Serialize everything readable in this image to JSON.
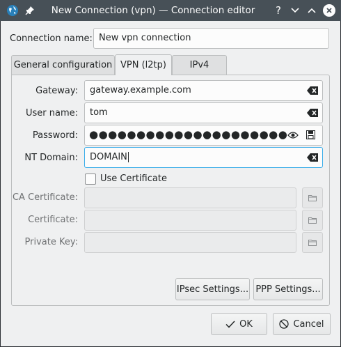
{
  "window": {
    "title": "New Connection (vpn) — Connection editor"
  },
  "titlebar": {
    "app_icon": "network-globe-icon",
    "pin_icon": "pin-icon",
    "help_label": "?",
    "minimize_icon": "chevron-down-icon",
    "maximize_icon": "chevron-up-icon",
    "close_icon": "close-icon"
  },
  "connection": {
    "label": "Connection name:",
    "value": "New vpn connection"
  },
  "tabs": [
    {
      "label": "General configuration",
      "active": false
    },
    {
      "label": "VPN (l2tp)",
      "active": true
    },
    {
      "label": "IPv4",
      "active": false
    }
  ],
  "form": {
    "gateway": {
      "label": "Gateway:",
      "value": "gateway.example.com"
    },
    "username": {
      "label": "User name:",
      "value": "tom"
    },
    "password": {
      "label": "Password:",
      "value": "●●●●●●●●●●●●●●●●●●●●●"
    },
    "nt_domain": {
      "label": "NT Domain:",
      "value": "DOMAIN"
    },
    "use_certificate": {
      "label": "Use Certificate",
      "checked": false
    },
    "ca_certificate": {
      "label": "CA Certificate:",
      "value": ""
    },
    "certificate": {
      "label": "Certificate:",
      "value": ""
    },
    "private_key": {
      "label": "Private Key:",
      "value": ""
    }
  },
  "buttons": {
    "ipsec": "IPsec Settings...",
    "ppp": "PPP Settings...",
    "ok": "OK",
    "cancel": "Cancel"
  },
  "colors": {
    "titlebar": "#475057",
    "window_bg": "#eff0f1",
    "focus_accent": "#3daee9",
    "text": "#232627"
  }
}
